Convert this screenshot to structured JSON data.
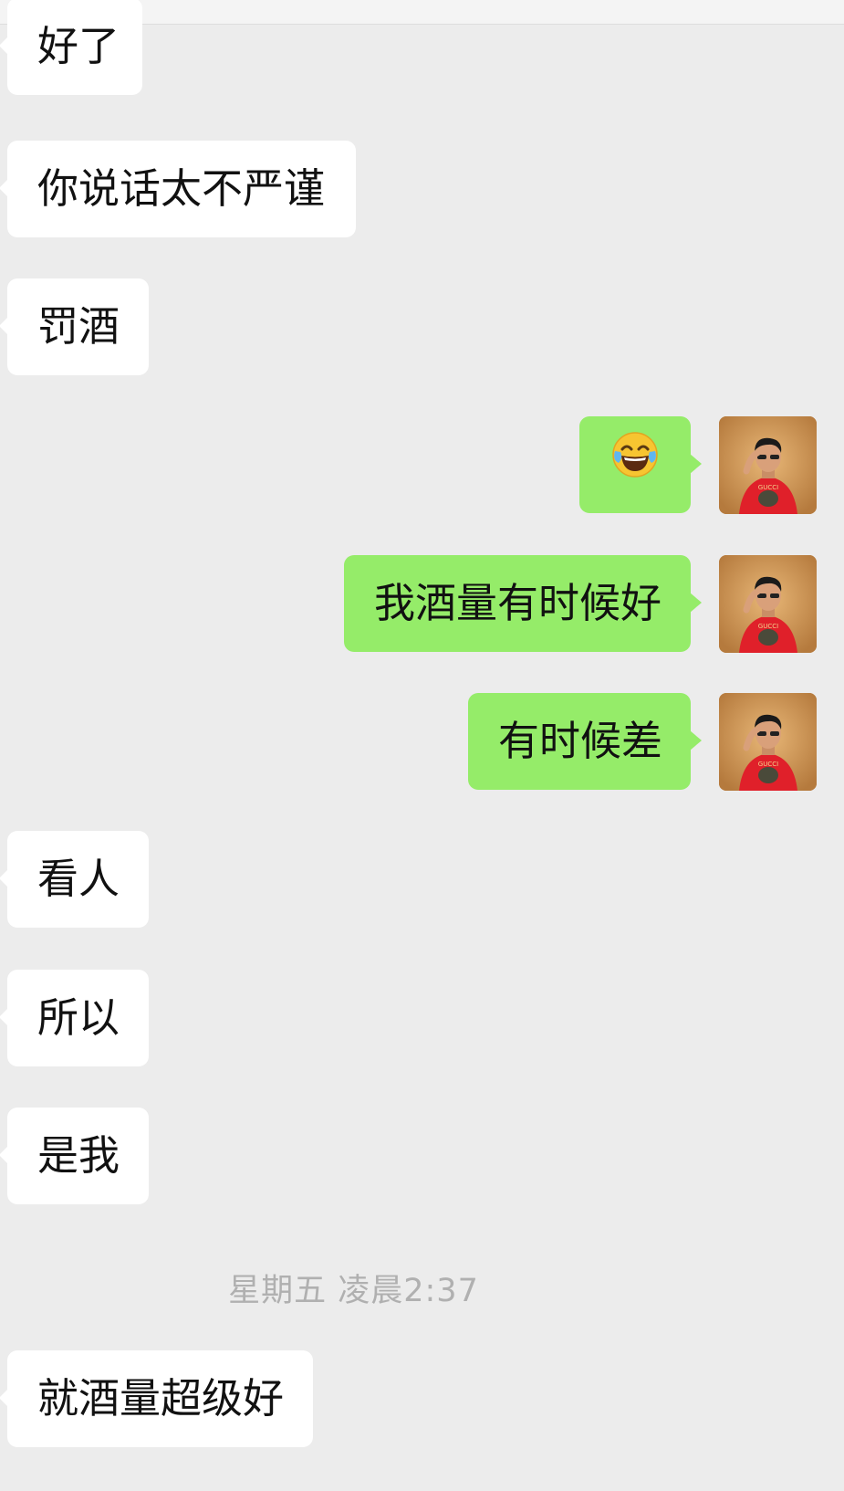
{
  "chat": {
    "messages": [
      {
        "side": "left",
        "text": "好了"
      },
      {
        "side": "left",
        "text": "你说话太不严谨"
      },
      {
        "side": "left",
        "text": "罚酒"
      },
      {
        "side": "right",
        "text": "",
        "emoji": "face-with-tears-of-joy-emoji"
      },
      {
        "side": "right",
        "text": "我酒量有时候好"
      },
      {
        "side": "right",
        "text": "有时候差"
      },
      {
        "side": "left",
        "text": "看人"
      },
      {
        "side": "left",
        "text": "所以"
      },
      {
        "side": "left",
        "text": "是我"
      },
      {
        "side": "left",
        "text": "就酒量超级好"
      }
    ],
    "timestamp": "星期五 凌晨2:37"
  },
  "colors": {
    "background": "#ececec",
    "incoming_bubble": "#ffffff",
    "outgoing_bubble": "#95ec69",
    "timestamp_text": "#b0b0b0"
  },
  "icons": {
    "user_avatar": "avatar"
  }
}
